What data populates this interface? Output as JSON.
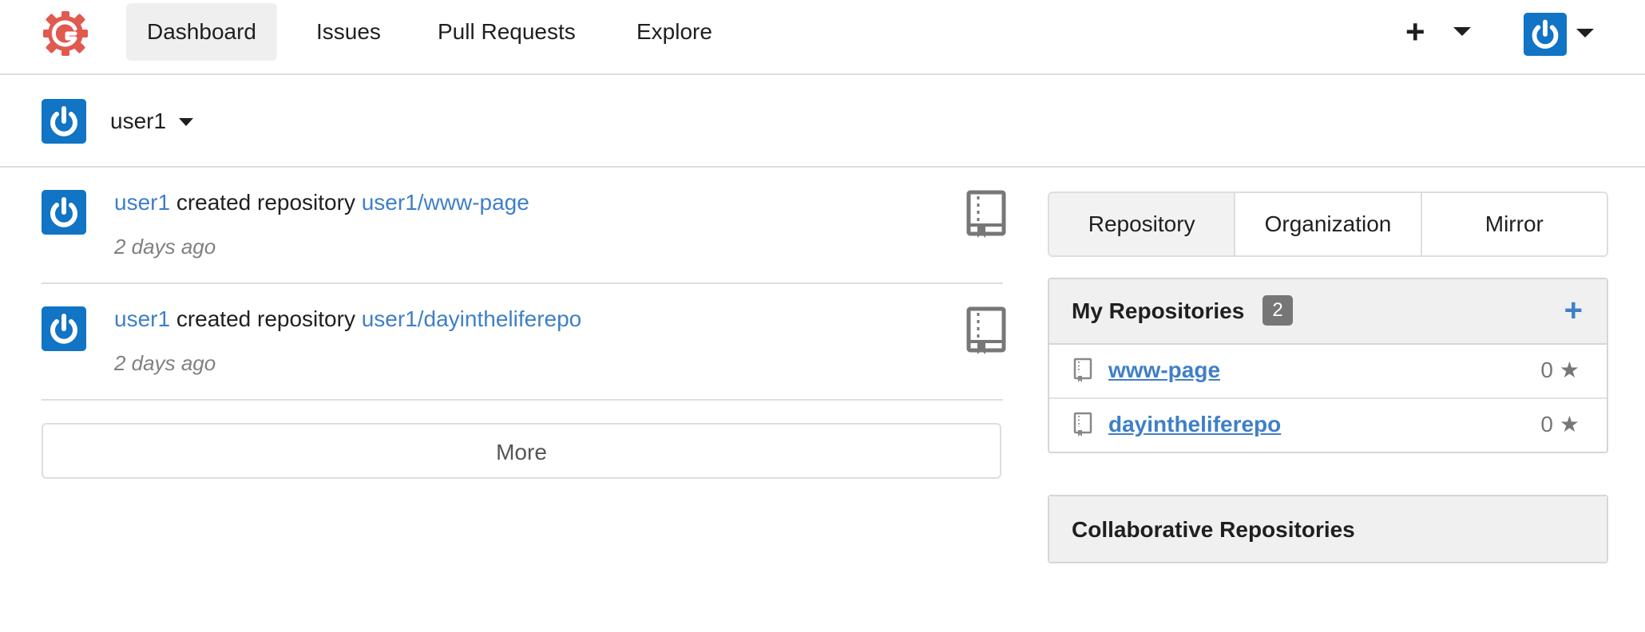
{
  "nav": {
    "items": [
      "Dashboard",
      "Issues",
      "Pull Requests",
      "Explore"
    ],
    "active": "Dashboard",
    "create_icon": "plus-icon",
    "accent": "#1174c4"
  },
  "context": {
    "user": "user1"
  },
  "feed": [
    {
      "actor": "user1",
      "action": "created repository",
      "repo": "user1/www-page",
      "time": "2 days ago",
      "icon": "book-icon"
    },
    {
      "actor": "user1",
      "action": "created repository",
      "repo": "user1/dayintheliferepo",
      "time": "2 days ago",
      "icon": "book-icon"
    }
  ],
  "more_label": "More",
  "sidebar": {
    "tabs": [
      "Repository",
      "Organization",
      "Mirror"
    ],
    "my_repos": {
      "title": "My Repositories",
      "count": "2",
      "add_icon": "plus-icon",
      "items": [
        {
          "name": "www-page",
          "stars": "0"
        },
        {
          "name": "dayintheliferepo",
          "stars": "0"
        }
      ]
    },
    "collab_title": "Collaborative Repositories"
  },
  "colors": {
    "link": "#3f7fc7",
    "logo": "#e05a4f",
    "badge": "#767676"
  }
}
